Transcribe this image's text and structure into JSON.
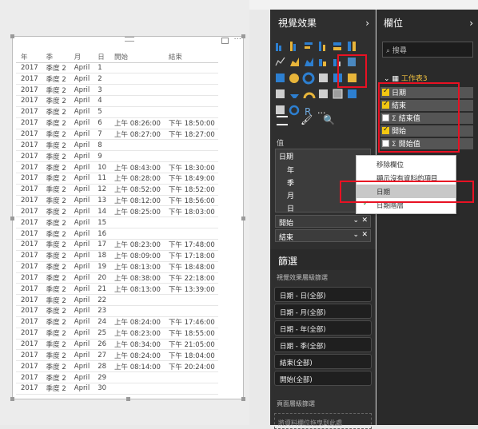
{
  "table": {
    "headers": [
      "年",
      "季",
      "月",
      "日",
      "開始",
      "結束"
    ],
    "rows": [
      [
        "2017",
        "季度 2",
        "April",
        "1",
        "",
        ""
      ],
      [
        "2017",
        "季度 2",
        "April",
        "2",
        "",
        ""
      ],
      [
        "2017",
        "季度 2",
        "April",
        "3",
        "",
        ""
      ],
      [
        "2017",
        "季度 2",
        "April",
        "4",
        "",
        ""
      ],
      [
        "2017",
        "季度 2",
        "April",
        "5",
        "",
        ""
      ],
      [
        "2017",
        "季度 2",
        "April",
        "6",
        "上午 08:26:00",
        "下午 18:50:00"
      ],
      [
        "2017",
        "季度 2",
        "April",
        "7",
        "上午 08:27:00",
        "下午 18:27:00"
      ],
      [
        "2017",
        "季度 2",
        "April",
        "8",
        "",
        ""
      ],
      [
        "2017",
        "季度 2",
        "April",
        "9",
        "",
        ""
      ],
      [
        "2017",
        "季度 2",
        "April",
        "10",
        "上午 08:43:00",
        "下午 18:30:00"
      ],
      [
        "2017",
        "季度 2",
        "April",
        "11",
        "上午 08:28:00",
        "下午 18:49:00"
      ],
      [
        "2017",
        "季度 2",
        "April",
        "12",
        "上午 08:52:00",
        "下午 18:52:00"
      ],
      [
        "2017",
        "季度 2",
        "April",
        "13",
        "上午 08:12:00",
        "下午 18:56:00"
      ],
      [
        "2017",
        "季度 2",
        "April",
        "14",
        "上午 08:25:00",
        "下午 18:03:00"
      ],
      [
        "2017",
        "季度 2",
        "April",
        "15",
        "",
        ""
      ],
      [
        "2017",
        "季度 2",
        "April",
        "16",
        "",
        ""
      ],
      [
        "2017",
        "季度 2",
        "April",
        "17",
        "上午 08:23:00",
        "下午 17:48:00"
      ],
      [
        "2017",
        "季度 2",
        "April",
        "18",
        "上午 08:09:00",
        "下午 17:18:00"
      ],
      [
        "2017",
        "季度 2",
        "April",
        "19",
        "上午 08:13:00",
        "下午 18:48:00"
      ],
      [
        "2017",
        "季度 2",
        "April",
        "20",
        "上午 08:38:00",
        "下午 22:18:00"
      ],
      [
        "2017",
        "季度 2",
        "April",
        "21",
        "上午 08:13:00",
        "下午 13:39:00"
      ],
      [
        "2017",
        "季度 2",
        "April",
        "22",
        "",
        ""
      ],
      [
        "2017",
        "季度 2",
        "April",
        "23",
        "",
        ""
      ],
      [
        "2017",
        "季度 2",
        "April",
        "24",
        "上午 08:24:00",
        "下午 17:46:00"
      ],
      [
        "2017",
        "季度 2",
        "April",
        "25",
        "上午 08:23:00",
        "下午 18:55:00"
      ],
      [
        "2017",
        "季度 2",
        "April",
        "26",
        "上午 08:34:00",
        "下午 21:05:00"
      ],
      [
        "2017",
        "季度 2",
        "April",
        "27",
        "上午 08:24:00",
        "下午 18:04:00"
      ],
      [
        "2017",
        "季度 2",
        "April",
        "28",
        "上午 08:14:00",
        "下午 20:24:00"
      ],
      [
        "2017",
        "季度 2",
        "April",
        "29",
        "",
        ""
      ],
      [
        "2017",
        "季度 2",
        "April",
        "30",
        "",
        ""
      ]
    ]
  },
  "viz_pane": {
    "title": "視覺效果",
    "values_label": "值",
    "date_field": "日期",
    "date_parts": [
      "年",
      "季",
      "月",
      "日"
    ],
    "start_field": "開始",
    "end_field": "結束",
    "r_icon": "R",
    "more": "..."
  },
  "filters": {
    "title": "篩選",
    "visual_level": "視覺效果層級篩選",
    "chips": [
      "日期 - 日(全部)",
      "日期 - 月(全部)",
      "日期 - 年(全部)",
      "日期 - 季(全部)",
      "結束(全部)",
      "開始(全部)"
    ],
    "page_level": "頁面層級篩選",
    "drop_hint": "將資料欄位拖曳到此處"
  },
  "fields_pane": {
    "title": "欄位",
    "search_placeholder": "搜尋",
    "table_name": "工作表3",
    "fields": [
      {
        "label": "日期",
        "checked": true,
        "sigma": false
      },
      {
        "label": "結束",
        "checked": true,
        "sigma": false
      },
      {
        "label": "結束值",
        "checked": false,
        "sigma": true
      },
      {
        "label": "開始",
        "checked": true,
        "sigma": false
      },
      {
        "label": "開始值",
        "checked": false,
        "sigma": true
      }
    ]
  },
  "context_menu": {
    "items": [
      "移除欄位",
      "顯示沒有資料的項目",
      "日期",
      "日期階層"
    ]
  }
}
